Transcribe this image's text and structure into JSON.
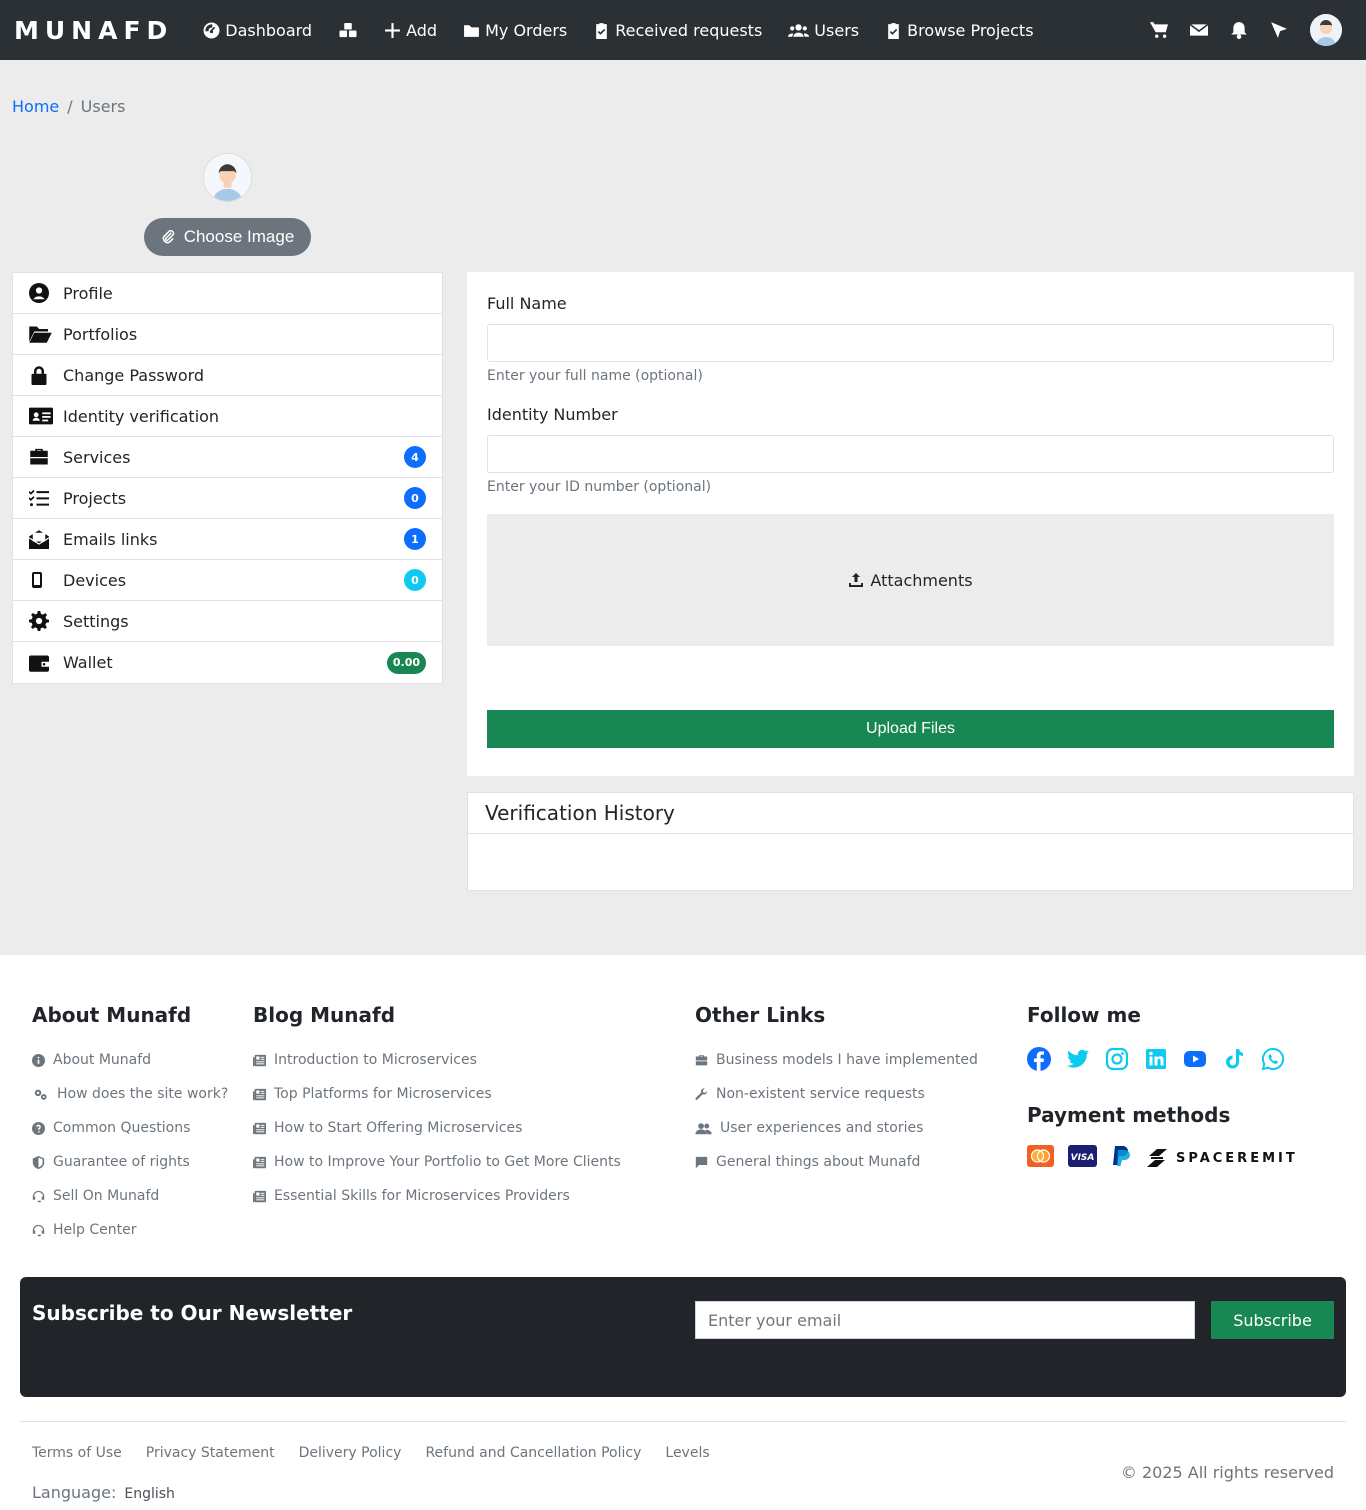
{
  "navbar": {
    "brand": "MUNAFD",
    "items": [
      {
        "label": "Dashboard",
        "icon": "dashboard-icon"
      },
      {
        "label": "",
        "icon": "cubes-icon"
      },
      {
        "label": "Add",
        "icon": "plus-icon"
      },
      {
        "label": "My Orders",
        "icon": "folder-icon"
      },
      {
        "label": "Received requests",
        "icon": "clipboard-icon"
      },
      {
        "label": "Users",
        "icon": "users-icon"
      },
      {
        "label": "Browse Projects",
        "icon": "clipboard-check-icon"
      }
    ],
    "right_icons": [
      "cart-icon",
      "envelope-icon",
      "bell-icon",
      "pointer-icon",
      "avatar"
    ]
  },
  "breadcrumb": {
    "home": "Home",
    "separator": "/",
    "current": "Users"
  },
  "profile": {
    "choose_image_label": "Choose Image"
  },
  "sidebar": {
    "items": [
      {
        "label": "Profile",
        "icon": "user-circle-icon"
      },
      {
        "label": "Portfolios",
        "icon": "folder-open-icon"
      },
      {
        "label": "Change Password",
        "icon": "lock-icon"
      },
      {
        "label": "Identity verification",
        "icon": "id-card-icon"
      },
      {
        "label": "Services",
        "icon": "briefcase-icon",
        "badge": "4",
        "badge_color": "#0d6efd"
      },
      {
        "label": "Projects",
        "icon": "list-check-icon",
        "badge": "0",
        "badge_color": "#0d6efd"
      },
      {
        "label": "Emails links",
        "icon": "envelope-open-icon",
        "badge": "1",
        "badge_color": "#0d6efd"
      },
      {
        "label": "Devices",
        "icon": "mobile-icon",
        "badge": "0",
        "badge_color": "#0dcaf0"
      },
      {
        "label": "Settings",
        "icon": "gear-icon"
      },
      {
        "label": "Wallet",
        "icon": "wallet-icon",
        "badge": "0.00",
        "badge_color": "#198754"
      }
    ]
  },
  "form": {
    "full_name_label": "Full Name",
    "full_name_value": "",
    "full_name_help": "Enter your full name (optional)",
    "id_label": "Identity Number",
    "id_value": "",
    "id_help": "Enter your ID number (optional)",
    "attachments_label": "Attachments",
    "upload_label": "Upload Files"
  },
  "history": {
    "title": "Verification History"
  },
  "footer": {
    "about": {
      "title": "About Munafd",
      "links": [
        {
          "label": "About Munafd",
          "icon": "info-icon"
        },
        {
          "label": "How does the site work?",
          "icon": "gears-icon"
        },
        {
          "label": "Common Questions",
          "icon": "question-icon"
        },
        {
          "label": "Guarantee of rights",
          "icon": "shield-icon"
        },
        {
          "label": "Sell On Munafd",
          "icon": "headset-icon"
        },
        {
          "label": "Help Center",
          "icon": "headset-icon"
        }
      ]
    },
    "blog": {
      "title": "Blog Munafd",
      "links": [
        {
          "label": "Introduction to Microservices",
          "icon": "newspaper-icon"
        },
        {
          "label": "Top Platforms for Microservices",
          "icon": "newspaper-icon"
        },
        {
          "label": "How to Start Offering Microservices",
          "icon": "newspaper-icon"
        },
        {
          "label": "How to Improve Your Portfolio to Get More Clients",
          "icon": "newspaper-icon"
        },
        {
          "label": "Essential Skills for Microservices Providers",
          "icon": "newspaper-icon"
        }
      ]
    },
    "other": {
      "title": "Other Links",
      "links": [
        {
          "label": "Business models I have implemented",
          "icon": "briefcase-icon"
        },
        {
          "label": "Non-existent service requests",
          "icon": "wrench-icon"
        },
        {
          "label": "User experiences and stories",
          "icon": "users-icon"
        },
        {
          "label": "General things about Munafd",
          "icon": "comment-icon"
        }
      ]
    },
    "follow": {
      "title": "Follow me",
      "social": [
        "facebook-icon",
        "twitter-icon",
        "instagram-icon",
        "linkedin-icon",
        "youtube-icon",
        "tiktok-icon",
        "whatsapp-icon"
      ],
      "payment_title": "Payment methods",
      "payment": [
        "mastercard-icon",
        "visa-icon",
        "paypal-icon",
        "spaceremit-logo"
      ],
      "spaceremit_text": "SPACEREMIT"
    },
    "newsletter": {
      "title": "Subscribe to Our Newsletter",
      "placeholder": "Enter your email",
      "button": "Subscribe"
    },
    "legal_links": [
      "Terms of Use",
      "Privacy Statement",
      "Delivery Policy",
      "Refund and Cancellation Policy",
      "Levels"
    ],
    "language_label": "Language:",
    "language_value": "English",
    "copyright": "© 2025 All rights reserved"
  },
  "colors": {
    "nav_bg": "#2b3035",
    "primary": "#0d6efd",
    "success": "#198754",
    "info": "#0dcaf0",
    "page_bg": "#ececec"
  }
}
